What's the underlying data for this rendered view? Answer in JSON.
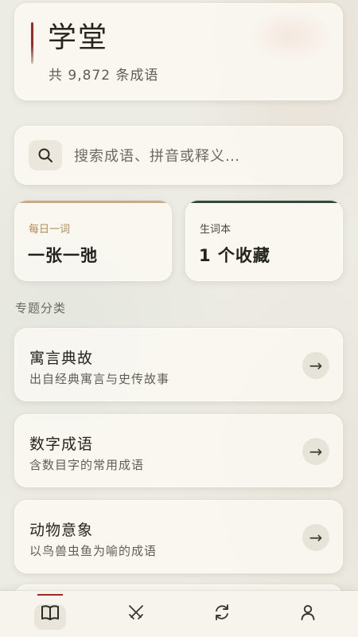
{
  "header": {
    "app_title": "学堂",
    "idiom_count": "共 9,872 条成语"
  },
  "search": {
    "placeholder": "搜索成语、拼音或释义…",
    "icon": "search-icon"
  },
  "daily_word": {
    "label": "每日一词",
    "value": "一张一弛"
  },
  "vocab_book": {
    "label": "生词本",
    "value": "1 个收藏"
  },
  "topics": {
    "section_title": "专题分类",
    "items": [
      {
        "title": "寓言典故",
        "description": "出自经典寓言与史传故事"
      },
      {
        "title": "数字成语",
        "description": "含数目字的常用成语"
      },
      {
        "title": "动物意象",
        "description": "以鸟兽虫鱼为喻的成语"
      }
    ],
    "arrow_glyph": "→"
  },
  "bottom_nav": {
    "items": [
      {
        "icon": "book-icon",
        "active": true
      },
      {
        "icon": "swords-icon",
        "active": false
      },
      {
        "icon": "refresh-icon",
        "active": false
      },
      {
        "icon": "user-icon",
        "active": false
      }
    ]
  },
  "colors": {
    "accent_red": "#9b2b23",
    "accent_gold": "#c9ab7e",
    "accent_green": "#2f4a3c",
    "background": "#ecebe4",
    "card": "#f9f7f0"
  }
}
